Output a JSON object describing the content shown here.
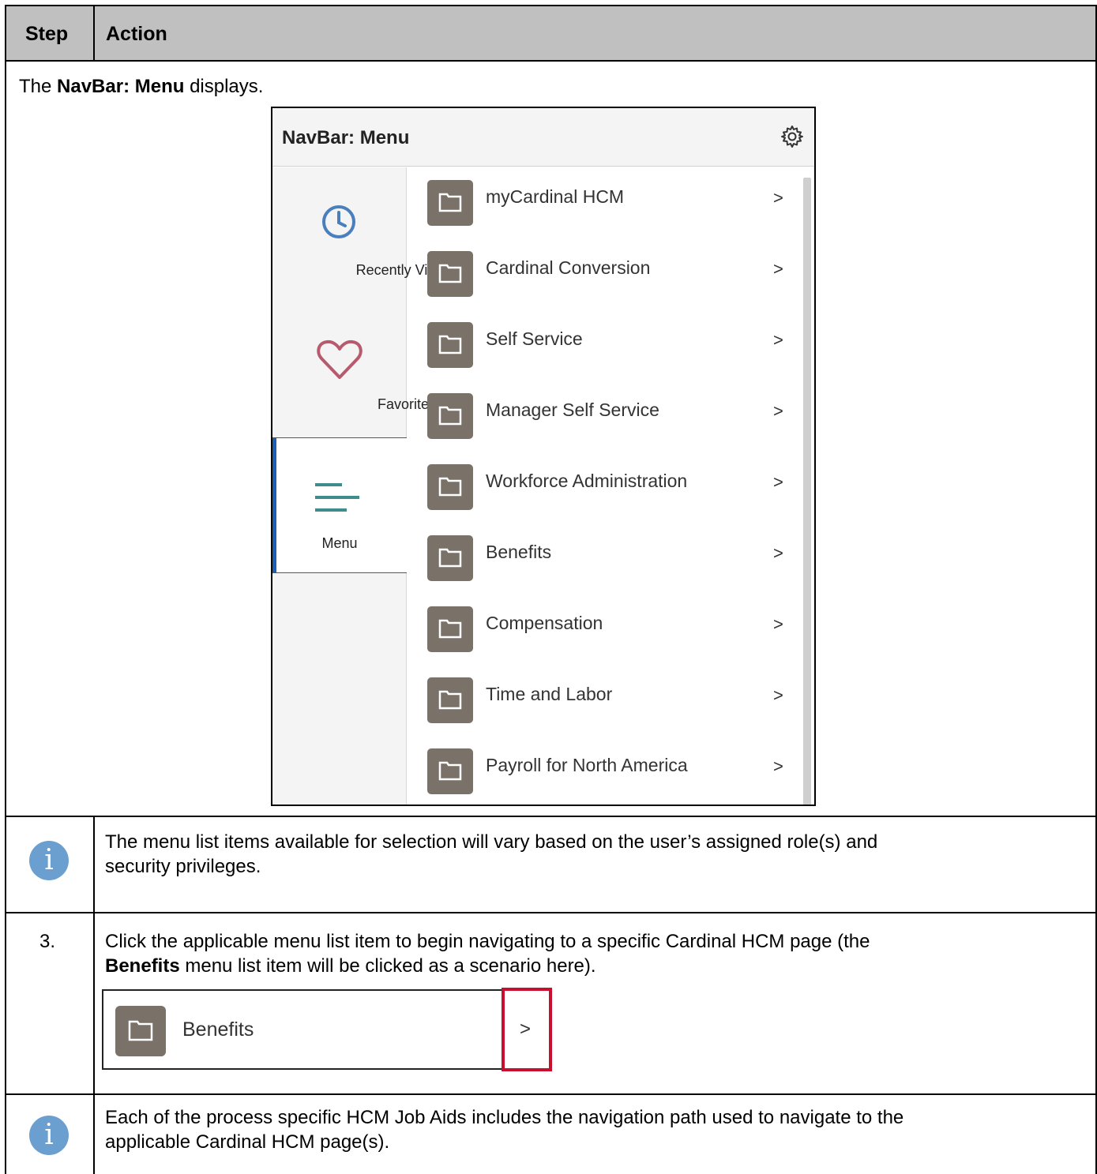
{
  "table": {
    "header": {
      "step": "Step",
      "action": "Action"
    },
    "intro": {
      "prefix": "The ",
      "bold": "NavBar: Menu",
      "suffix": " displays."
    }
  },
  "navbar": {
    "title": "NavBar: Menu",
    "gear_icon": "gear-icon",
    "side_items": [
      {
        "label": "Recently Visited",
        "icon": "clock-icon",
        "color": "#4a7fbd"
      },
      {
        "label": "Favorites",
        "icon": "heart-icon",
        "color": "#b85a6e"
      },
      {
        "label": "Menu",
        "icon": "menu-lines-icon",
        "color": "#3f8c8a"
      }
    ],
    "menu_items": [
      {
        "label": "myCardinal HCM"
      },
      {
        "label": "Cardinal Conversion"
      },
      {
        "label": "Self Service"
      },
      {
        "label": "Manager Self Service"
      },
      {
        "label": "Workforce Administration"
      },
      {
        "label": "Benefits"
      },
      {
        "label": "Compensation"
      },
      {
        "label": "Time and Labor"
      },
      {
        "label": "Payroll for North America"
      }
    ],
    "chevron": ">"
  },
  "note1": {
    "icon": "i",
    "line1": "The menu list items available for selection will vary based on the user’s assigned role(s) and",
    "line2": "security privileges."
  },
  "step3": {
    "number": "3.",
    "line1": "Click the applicable menu list item to begin navigating to a specific Cardinal HCM page (the",
    "bold": "Benefits",
    "line2_rest": " menu list item will be clicked as a scenario here).",
    "example_label": "Benefits",
    "example_chevron": ">",
    "highlight_color": "#c8102e"
  },
  "note2": {
    "icon": "i",
    "line1": "Each of the process specific HCM Job Aids includes the navigation path used to navigate to the",
    "line2": "applicable Cardinal HCM page(s)."
  }
}
